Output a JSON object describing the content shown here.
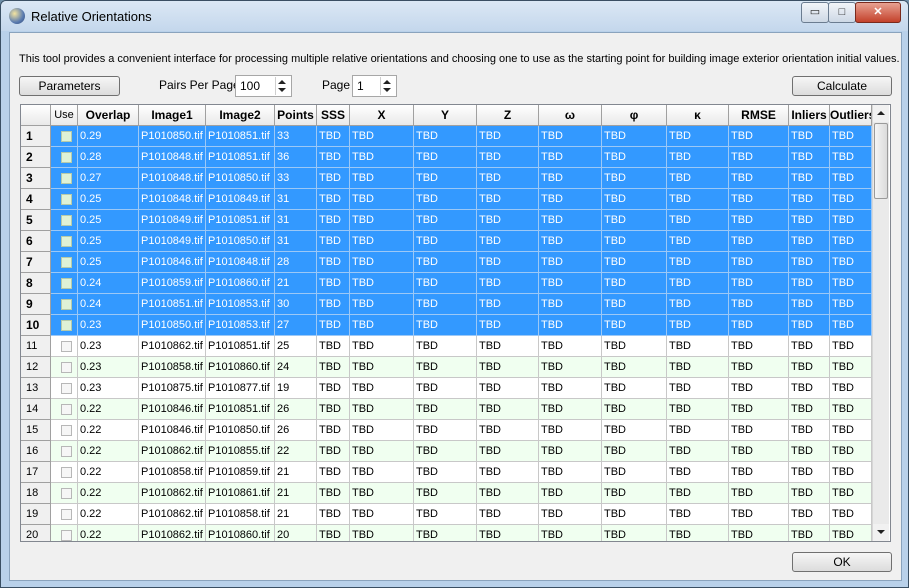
{
  "window": {
    "title": "Relative Orientations",
    "minimize": "▭",
    "maximize": "□",
    "close": "✕"
  },
  "description": "This tool provides a convenient interface for processing multiple relative orientations and choosing one to use as the starting point for building image exterior orientation initial values.",
  "toolbar": {
    "parameters_label": "Parameters",
    "pairs_per_page_label": "Pairs Per Page",
    "pairs_per_page_value": "100",
    "page_label": "Page",
    "page_value": "1",
    "calculate_label": "Calculate"
  },
  "table": {
    "columns": [
      "Use",
      "Overlap",
      "Image1",
      "Image2",
      "Points",
      "SSS",
      "X",
      "Y",
      "Z",
      "ω",
      "φ",
      "κ",
      "RMSE",
      "Inliers",
      "Outliers"
    ],
    "rows": [
      {
        "num": "1",
        "overlap": "0.29",
        "image1": "P1010850.tif",
        "image2": "P1010851.tif",
        "points": "33",
        "selected": true
      },
      {
        "num": "2",
        "overlap": "0.28",
        "image1": "P1010848.tif",
        "image2": "P1010851.tif",
        "points": "36",
        "selected": true
      },
      {
        "num": "3",
        "overlap": "0.27",
        "image1": "P1010848.tif",
        "image2": "P1010850.tif",
        "points": "33",
        "selected": true
      },
      {
        "num": "4",
        "overlap": "0.25",
        "image1": "P1010848.tif",
        "image2": "P1010849.tif",
        "points": "31",
        "selected": true
      },
      {
        "num": "5",
        "overlap": "0.25",
        "image1": "P1010849.tif",
        "image2": "P1010851.tif",
        "points": "31",
        "selected": true
      },
      {
        "num": "6",
        "overlap": "0.25",
        "image1": "P1010849.tif",
        "image2": "P1010850.tif",
        "points": "31",
        "selected": true
      },
      {
        "num": "7",
        "overlap": "0.25",
        "image1": "P1010846.tif",
        "image2": "P1010848.tif",
        "points": "28",
        "selected": true
      },
      {
        "num": "8",
        "overlap": "0.24",
        "image1": "P1010859.tif",
        "image2": "P1010860.tif",
        "points": "21",
        "selected": true
      },
      {
        "num": "9",
        "overlap": "0.24",
        "image1": "P1010851.tif",
        "image2": "P1010853.tif",
        "points": "30",
        "selected": true
      },
      {
        "num": "10",
        "overlap": "0.23",
        "image1": "P1010850.tif",
        "image2": "P1010853.tif",
        "points": "27",
        "selected": true
      },
      {
        "num": "11",
        "overlap": "0.23",
        "image1": "P1010862.tif",
        "image2": "P1010851.tif",
        "points": "25",
        "selected": false
      },
      {
        "num": "12",
        "overlap": "0.23",
        "image1": "P1010858.tif",
        "image2": "P1010860.tif",
        "points": "24",
        "selected": false
      },
      {
        "num": "13",
        "overlap": "0.23",
        "image1": "P1010875.tif",
        "image2": "P1010877.tif",
        "points": "19",
        "selected": false
      },
      {
        "num": "14",
        "overlap": "0.22",
        "image1": "P1010846.tif",
        "image2": "P1010851.tif",
        "points": "26",
        "selected": false
      },
      {
        "num": "15",
        "overlap": "0.22",
        "image1": "P1010846.tif",
        "image2": "P1010850.tif",
        "points": "26",
        "selected": false
      },
      {
        "num": "16",
        "overlap": "0.22",
        "image1": "P1010862.tif",
        "image2": "P1010855.tif",
        "points": "22",
        "selected": false
      },
      {
        "num": "17",
        "overlap": "0.22",
        "image1": "P1010858.tif",
        "image2": "P1010859.tif",
        "points": "21",
        "selected": false
      },
      {
        "num": "18",
        "overlap": "0.22",
        "image1": "P1010862.tif",
        "image2": "P1010861.tif",
        "points": "21",
        "selected": false
      },
      {
        "num": "19",
        "overlap": "0.22",
        "image1": "P1010862.tif",
        "image2": "P1010858.tif",
        "points": "21",
        "selected": false
      },
      {
        "num": "20",
        "overlap": "0.22",
        "image1": "P1010862.tif",
        "image2": "P1010860.tif",
        "points": "20",
        "selected": false
      }
    ],
    "tbd": "TBD"
  },
  "footer": {
    "ok_label": "OK"
  },
  "colors": {
    "selection": "#3399ff",
    "alt_row": "#f0fff0"
  },
  "icons": {
    "app": "globe-icon"
  }
}
